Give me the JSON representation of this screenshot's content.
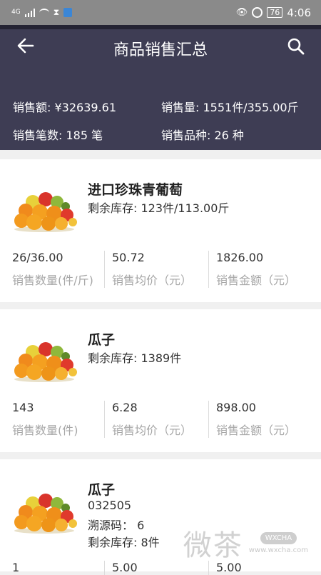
{
  "status_bar": {
    "signal": "4G",
    "battery": "76",
    "time": "4:06"
  },
  "header": {
    "title": "商品销售汇总",
    "stats": {
      "sales_amount": "销售额: ¥32639.61",
      "sales_volume": "销售量: 1551件/355.00斤",
      "order_count": "销售笔数: 185 笔",
      "variety_count": "销售品种: 26 种"
    }
  },
  "products": [
    {
      "name": "进口珍珠青葡萄",
      "lines": [
        "剩余库存: 123件/113.00斤"
      ],
      "metrics": [
        {
          "value": "26/36.00",
          "label": "销售数量(件/斤)"
        },
        {
          "value": "50.72",
          "label": "销售均价（元）"
        },
        {
          "value": "1826.00",
          "label": "销售金额（元）"
        }
      ]
    },
    {
      "name": "瓜子",
      "lines": [
        "剩余库存: 1389件"
      ],
      "metrics": [
        {
          "value": "143",
          "label": "销售数量(件)"
        },
        {
          "value": "6.28",
          "label": "销售均价（元）"
        },
        {
          "value": "898.00",
          "label": "销售金额（元）"
        }
      ]
    },
    {
      "name": "瓜子",
      "lines": [
        "032505",
        "溯源码： 6",
        "剩余库存: 8件"
      ],
      "metrics": [
        {
          "value": "1",
          "label": ""
        },
        {
          "value": "5.00",
          "label": ""
        },
        {
          "value": "5.00",
          "label": ""
        }
      ]
    }
  ],
  "watermark": {
    "big": "微茶",
    "small": "WXCHA",
    "url": "www.wxcha.com"
  },
  "colors": {
    "header_bg": "#3e3d54",
    "status_bg": "#8a8a8a",
    "label_gray": "#a7a7a7"
  }
}
